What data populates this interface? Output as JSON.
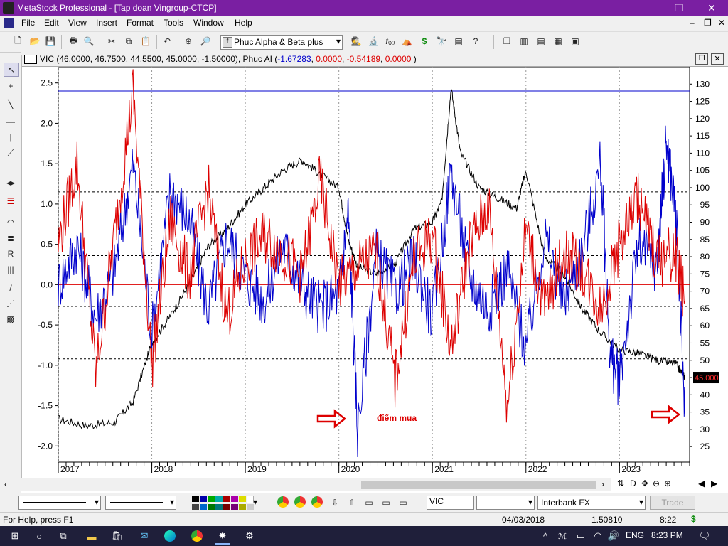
{
  "window": {
    "title": "MetaStock Professional - [Tap doan Vingroup-CTCP]",
    "controls": [
      "–",
      "❐",
      "✕"
    ]
  },
  "menu": [
    "File",
    "Edit",
    "View",
    "Insert",
    "Format",
    "Tools",
    "Window",
    "Help"
  ],
  "toolbar": {
    "indicator_select": "Phuc  Alpha & Beta plus"
  },
  "chart": {
    "header_prefix": "VIC (46.0000, 46.7500, 44.5500, 45.0000, -1.50000), Phuc  AI (",
    "header_blue": "-1.67283",
    "header_sep1": ", ",
    "header_red1": "0.0000",
    "header_sep2": ", ",
    "header_red2": "-0.54189",
    "header_sep3": ", ",
    "header_red3": "0.0000",
    "header_suffix": " )",
    "annotation": "điểm mua",
    "price_tag": "45.000",
    "colors": {
      "price": "#000000",
      "alpha": "#0000cc",
      "beta": "#dd0000",
      "hline": "#0000cc",
      "zeroline": "#dd0000",
      "annotation": "#dd0000"
    }
  },
  "chart_data": {
    "type": "line",
    "x_axis_labels": [
      "2017",
      "2018",
      "2019",
      "2020",
      "2021",
      "2022",
      "2023"
    ],
    "y_left_ticks": [
      "2.5",
      "2.0",
      "1.5",
      "1.0",
      "0.5",
      "0.0",
      "-0.5",
      "-1.0",
      "-1.5",
      "-2.0"
    ],
    "y_right_ticks": [
      "130",
      "125",
      "120",
      "115",
      "110",
      "105",
      "100",
      "95",
      "90",
      "85",
      "80",
      "75",
      "70",
      "65",
      "60",
      "55",
      "50",
      "45",
      "40",
      "35",
      "30",
      "25"
    ],
    "y_left_range": [
      -2.2,
      2.7
    ],
    "y_right_range": [
      20.5,
      135
    ],
    "reference_lines_left": [
      2.4,
      1.15,
      0.36,
      -0.27,
      -0.92
    ],
    "zero_line": 0.0,
    "series": [
      {
        "values_axis": "right",
        "x": [
          2017.0,
          2017.3,
          2017.6,
          2017.8,
          2018.0,
          2018.2,
          2018.4,
          2018.6,
          2018.8,
          2019.0,
          2019.2,
          2019.4,
          2019.6,
          2019.8,
          2020.0,
          2020.1,
          2020.2,
          2020.4,
          2020.6,
          2020.8,
          2021.0,
          2021.1,
          2021.2,
          2021.3,
          2021.5,
          2021.7,
          2021.9,
          2022.0,
          2022.2,
          2022.4,
          2022.6,
          2022.8,
          2023.0,
          2023.2,
          2023.4,
          2023.6,
          2023.7
        ],
        "values": [
          33,
          31,
          32,
          38,
          55,
          63,
          72,
          83,
          88,
          95,
          100,
          105,
          108,
          104,
          100,
          85,
          77,
          75,
          78,
          88,
          90,
          96,
          129,
          110,
          100,
          97,
          94,
          105,
          80,
          75,
          65,
          58,
          53,
          52,
          50,
          49,
          45
        ]
      },
      {
        "values_axis": "left",
        "x": [
          2017.0,
          2017.2,
          2017.4,
          2017.6,
          2017.8,
          2018.0,
          2018.2,
          2018.4,
          2018.6,
          2018.8,
          2019.0,
          2019.2,
          2019.4,
          2019.6,
          2019.8,
          2020.0,
          2020.1,
          2020.2,
          2020.4,
          2020.6,
          2020.8,
          2021.0,
          2021.2,
          2021.4,
          2021.6,
          2021.8,
          2022.0,
          2022.2,
          2022.4,
          2022.6,
          2022.8,
          2022.9,
          2023.0,
          2023.2,
          2023.4,
          2023.5,
          2023.6,
          2023.7
        ],
        "values": [
          0.0,
          0.5,
          -0.4,
          0.2,
          1.5,
          -0.6,
          1.2,
          0.8,
          -0.3,
          0.6,
          0.1,
          -0.2,
          0.5,
          0.0,
          -0.3,
          -0.1,
          0.9,
          -1.8,
          0.4,
          -0.1,
          0.3,
          -0.4,
          1.4,
          0.1,
          -0.3,
          0.2,
          -0.8,
          0.6,
          -0.2,
          0.4,
          1.5,
          -0.9,
          -1.2,
          0.5,
          0.2,
          1.8,
          0.9,
          -1.6
        ]
      },
      {
        "values_axis": "left",
        "x": [
          2017.0,
          2017.2,
          2017.4,
          2017.6,
          2017.8,
          2018.0,
          2018.2,
          2018.4,
          2018.6,
          2018.8,
          2019.0,
          2019.2,
          2019.4,
          2019.6,
          2019.8,
          2020.0,
          2020.2,
          2020.4,
          2020.6,
          2020.8,
          2021.0,
          2021.2,
          2021.4,
          2021.6,
          2021.8,
          2022.0,
          2022.2,
          2022.4,
          2022.6,
          2022.8,
          2023.0,
          2023.2,
          2023.4,
          2023.6,
          2023.7
        ],
        "values": [
          0.5,
          1.5,
          -1.1,
          0.6,
          2.4,
          -1.0,
          0.8,
          0.1,
          1.2,
          -0.4,
          0.3,
          0.6,
          0.4,
          0.1,
          1.3,
          0.0,
          0.2,
          0.4,
          -1.2,
          0.3,
          0.6,
          -0.8,
          0.5,
          1.0,
          -1.5,
          0.7,
          -0.3,
          0.4,
          0.2,
          -0.3,
          0.5,
          1.1,
          0.3,
          0.4,
          -0.2
        ]
      }
    ]
  },
  "bottombar": {
    "symbol": "VIC",
    "interbank": "Interbank FX",
    "trade": "Trade"
  },
  "status": {
    "help": "For Help, press F1",
    "date": "04/03/2018",
    "value": "1.50810",
    "time": "8:22",
    "dollar": "$"
  },
  "taskbar": {
    "lang": "ENG",
    "clock": "8:23 PM"
  }
}
